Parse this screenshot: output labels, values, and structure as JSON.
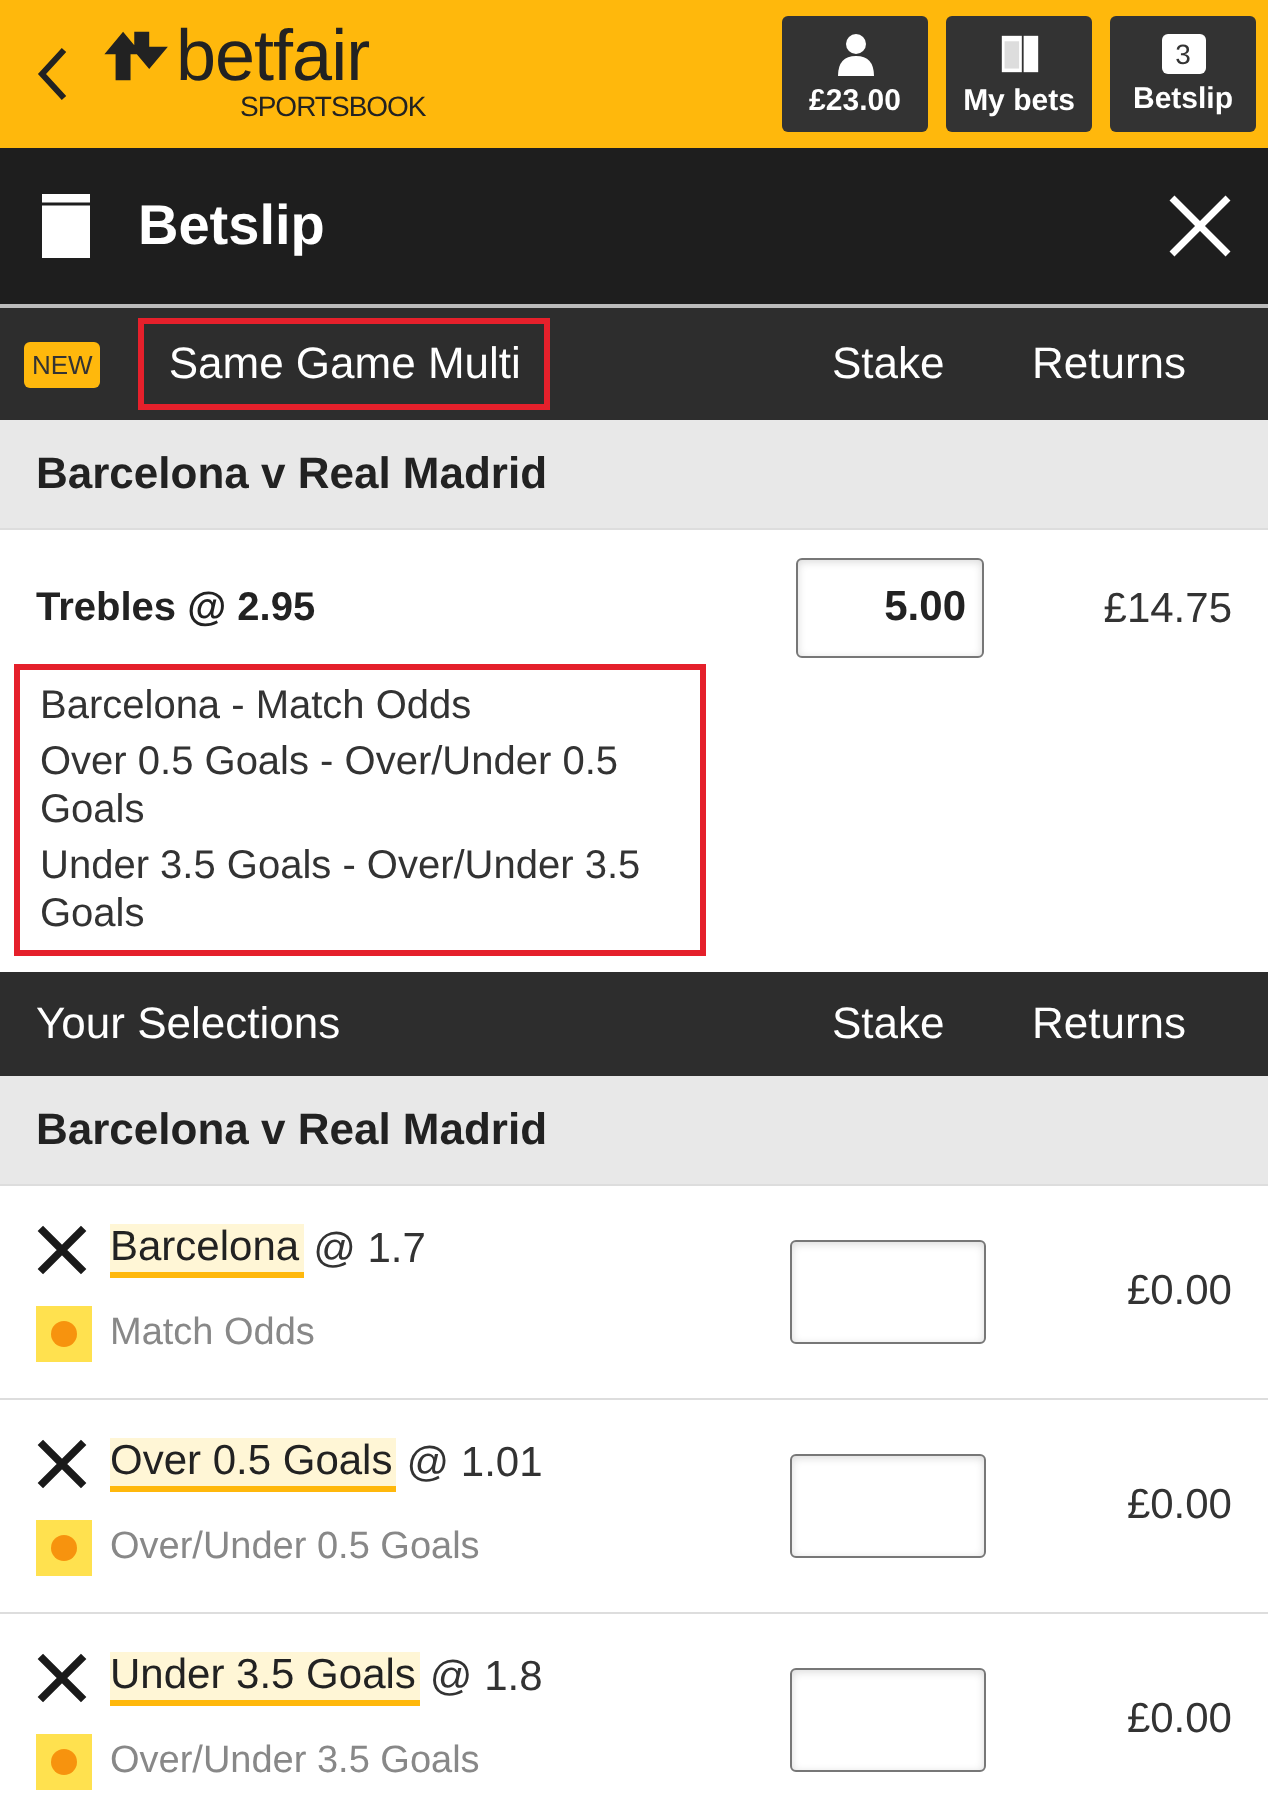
{
  "header": {
    "logo": {
      "name": "betfair",
      "subtitle": "SPORTSBOOK"
    },
    "buttons": [
      {
        "kind": "account",
        "label": "£23.00"
      },
      {
        "kind": "mybets",
        "label": "My bets"
      },
      {
        "kind": "betslip",
        "label": "Betslip",
        "badge": "3"
      }
    ]
  },
  "title_bar": {
    "title": "Betslip"
  },
  "multi": {
    "badge": "NEW",
    "title": "Same Game Multi",
    "title_highlighted": true,
    "stake_heading": "Stake",
    "returns_heading": "Returns",
    "event": "Barcelona v Real Madrid",
    "bet": {
      "title": "Trebles @ 2.95",
      "stake": "5.00",
      "returns": "£14.75",
      "legs_highlighted": true,
      "legs": [
        "Barcelona - Match Odds",
        "Over 0.5 Goals - Over/Under 0.5 Goals",
        "Under 3.5 Goals - Over/Under 3.5 Goals"
      ]
    }
  },
  "selections": {
    "title": "Your Selections",
    "stake_heading": "Stake",
    "returns_heading": "Returns",
    "event": "Barcelona v Real Madrid",
    "items": [
      {
        "name": "Barcelona",
        "odds": "@ 1.7",
        "market": "Match Odds",
        "returns": "£0.00"
      },
      {
        "name": "Over 0.5 Goals",
        "odds": "@ 1.01",
        "market": "Over/Under 0.5 Goals",
        "returns": "£0.00"
      },
      {
        "name": "Under 3.5 Goals",
        "odds": "@ 1.8",
        "market": "Over/Under 3.5 Goals",
        "returns": "£0.00"
      }
    ]
  }
}
